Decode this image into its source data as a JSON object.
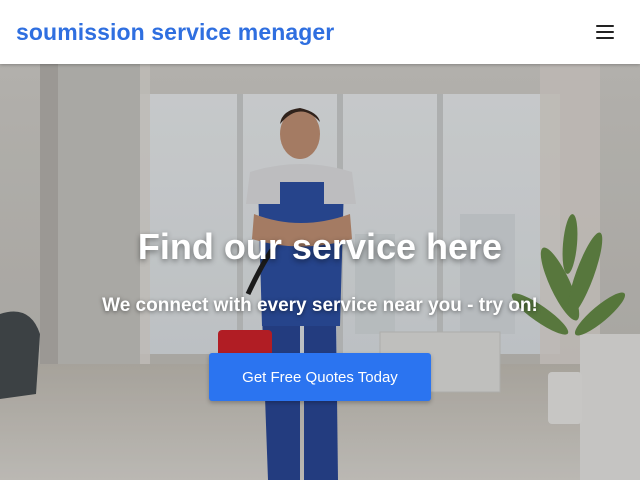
{
  "header": {
    "brand": "soumission service menager",
    "menu_icon": "hamburger-menu-icon"
  },
  "hero": {
    "image_description": "cleaning worker in blue overalls holding a mop bucket in a bright apartment",
    "title": "Find our service here",
    "subtitle": "We connect with every service near you - try on!",
    "cta_label": "Get Free Quotes Today"
  },
  "colors": {
    "brand": "#2f6fe0",
    "cta_background": "#2b74f0",
    "header_background": "#ffffff"
  }
}
